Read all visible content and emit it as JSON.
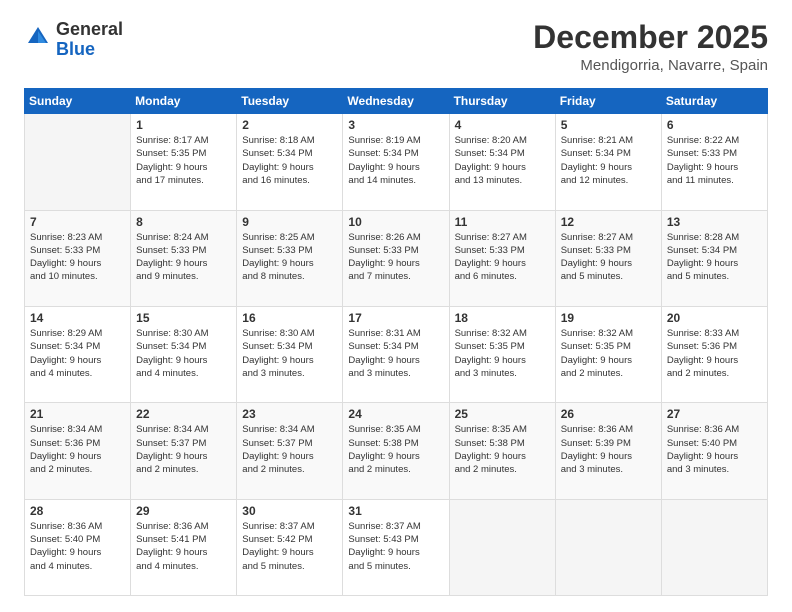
{
  "logo": {
    "general": "General",
    "blue": "Blue"
  },
  "header": {
    "title": "December 2025",
    "subtitle": "Mendigorria, Navarre, Spain"
  },
  "weekdays": [
    "Sunday",
    "Monday",
    "Tuesday",
    "Wednesday",
    "Thursday",
    "Friday",
    "Saturday"
  ],
  "weeks": [
    [
      {
        "day": "",
        "info": ""
      },
      {
        "day": "1",
        "info": "Sunrise: 8:17 AM\nSunset: 5:35 PM\nDaylight: 9 hours\nand 17 minutes."
      },
      {
        "day": "2",
        "info": "Sunrise: 8:18 AM\nSunset: 5:34 PM\nDaylight: 9 hours\nand 16 minutes."
      },
      {
        "day": "3",
        "info": "Sunrise: 8:19 AM\nSunset: 5:34 PM\nDaylight: 9 hours\nand 14 minutes."
      },
      {
        "day": "4",
        "info": "Sunrise: 8:20 AM\nSunset: 5:34 PM\nDaylight: 9 hours\nand 13 minutes."
      },
      {
        "day": "5",
        "info": "Sunrise: 8:21 AM\nSunset: 5:34 PM\nDaylight: 9 hours\nand 12 minutes."
      },
      {
        "day": "6",
        "info": "Sunrise: 8:22 AM\nSunset: 5:33 PM\nDaylight: 9 hours\nand 11 minutes."
      }
    ],
    [
      {
        "day": "7",
        "info": "Sunrise: 8:23 AM\nSunset: 5:33 PM\nDaylight: 9 hours\nand 10 minutes."
      },
      {
        "day": "8",
        "info": "Sunrise: 8:24 AM\nSunset: 5:33 PM\nDaylight: 9 hours\nand 9 minutes."
      },
      {
        "day": "9",
        "info": "Sunrise: 8:25 AM\nSunset: 5:33 PM\nDaylight: 9 hours\nand 8 minutes."
      },
      {
        "day": "10",
        "info": "Sunrise: 8:26 AM\nSunset: 5:33 PM\nDaylight: 9 hours\nand 7 minutes."
      },
      {
        "day": "11",
        "info": "Sunrise: 8:27 AM\nSunset: 5:33 PM\nDaylight: 9 hours\nand 6 minutes."
      },
      {
        "day": "12",
        "info": "Sunrise: 8:27 AM\nSunset: 5:33 PM\nDaylight: 9 hours\nand 5 minutes."
      },
      {
        "day": "13",
        "info": "Sunrise: 8:28 AM\nSunset: 5:34 PM\nDaylight: 9 hours\nand 5 minutes."
      }
    ],
    [
      {
        "day": "14",
        "info": "Sunrise: 8:29 AM\nSunset: 5:34 PM\nDaylight: 9 hours\nand 4 minutes."
      },
      {
        "day": "15",
        "info": "Sunrise: 8:30 AM\nSunset: 5:34 PM\nDaylight: 9 hours\nand 4 minutes."
      },
      {
        "day": "16",
        "info": "Sunrise: 8:30 AM\nSunset: 5:34 PM\nDaylight: 9 hours\nand 3 minutes."
      },
      {
        "day": "17",
        "info": "Sunrise: 8:31 AM\nSunset: 5:34 PM\nDaylight: 9 hours\nand 3 minutes."
      },
      {
        "day": "18",
        "info": "Sunrise: 8:32 AM\nSunset: 5:35 PM\nDaylight: 9 hours\nand 3 minutes."
      },
      {
        "day": "19",
        "info": "Sunrise: 8:32 AM\nSunset: 5:35 PM\nDaylight: 9 hours\nand 2 minutes."
      },
      {
        "day": "20",
        "info": "Sunrise: 8:33 AM\nSunset: 5:36 PM\nDaylight: 9 hours\nand 2 minutes."
      }
    ],
    [
      {
        "day": "21",
        "info": "Sunrise: 8:34 AM\nSunset: 5:36 PM\nDaylight: 9 hours\nand 2 minutes."
      },
      {
        "day": "22",
        "info": "Sunrise: 8:34 AM\nSunset: 5:37 PM\nDaylight: 9 hours\nand 2 minutes."
      },
      {
        "day": "23",
        "info": "Sunrise: 8:34 AM\nSunset: 5:37 PM\nDaylight: 9 hours\nand 2 minutes."
      },
      {
        "day": "24",
        "info": "Sunrise: 8:35 AM\nSunset: 5:38 PM\nDaylight: 9 hours\nand 2 minutes."
      },
      {
        "day": "25",
        "info": "Sunrise: 8:35 AM\nSunset: 5:38 PM\nDaylight: 9 hours\nand 2 minutes."
      },
      {
        "day": "26",
        "info": "Sunrise: 8:36 AM\nSunset: 5:39 PM\nDaylight: 9 hours\nand 3 minutes."
      },
      {
        "day": "27",
        "info": "Sunrise: 8:36 AM\nSunset: 5:40 PM\nDaylight: 9 hours\nand 3 minutes."
      }
    ],
    [
      {
        "day": "28",
        "info": "Sunrise: 8:36 AM\nSunset: 5:40 PM\nDaylight: 9 hours\nand 4 minutes."
      },
      {
        "day": "29",
        "info": "Sunrise: 8:36 AM\nSunset: 5:41 PM\nDaylight: 9 hours\nand 4 minutes."
      },
      {
        "day": "30",
        "info": "Sunrise: 8:37 AM\nSunset: 5:42 PM\nDaylight: 9 hours\nand 5 minutes."
      },
      {
        "day": "31",
        "info": "Sunrise: 8:37 AM\nSunset: 5:43 PM\nDaylight: 9 hours\nand 5 minutes."
      },
      {
        "day": "",
        "info": ""
      },
      {
        "day": "",
        "info": ""
      },
      {
        "day": "",
        "info": ""
      }
    ]
  ]
}
